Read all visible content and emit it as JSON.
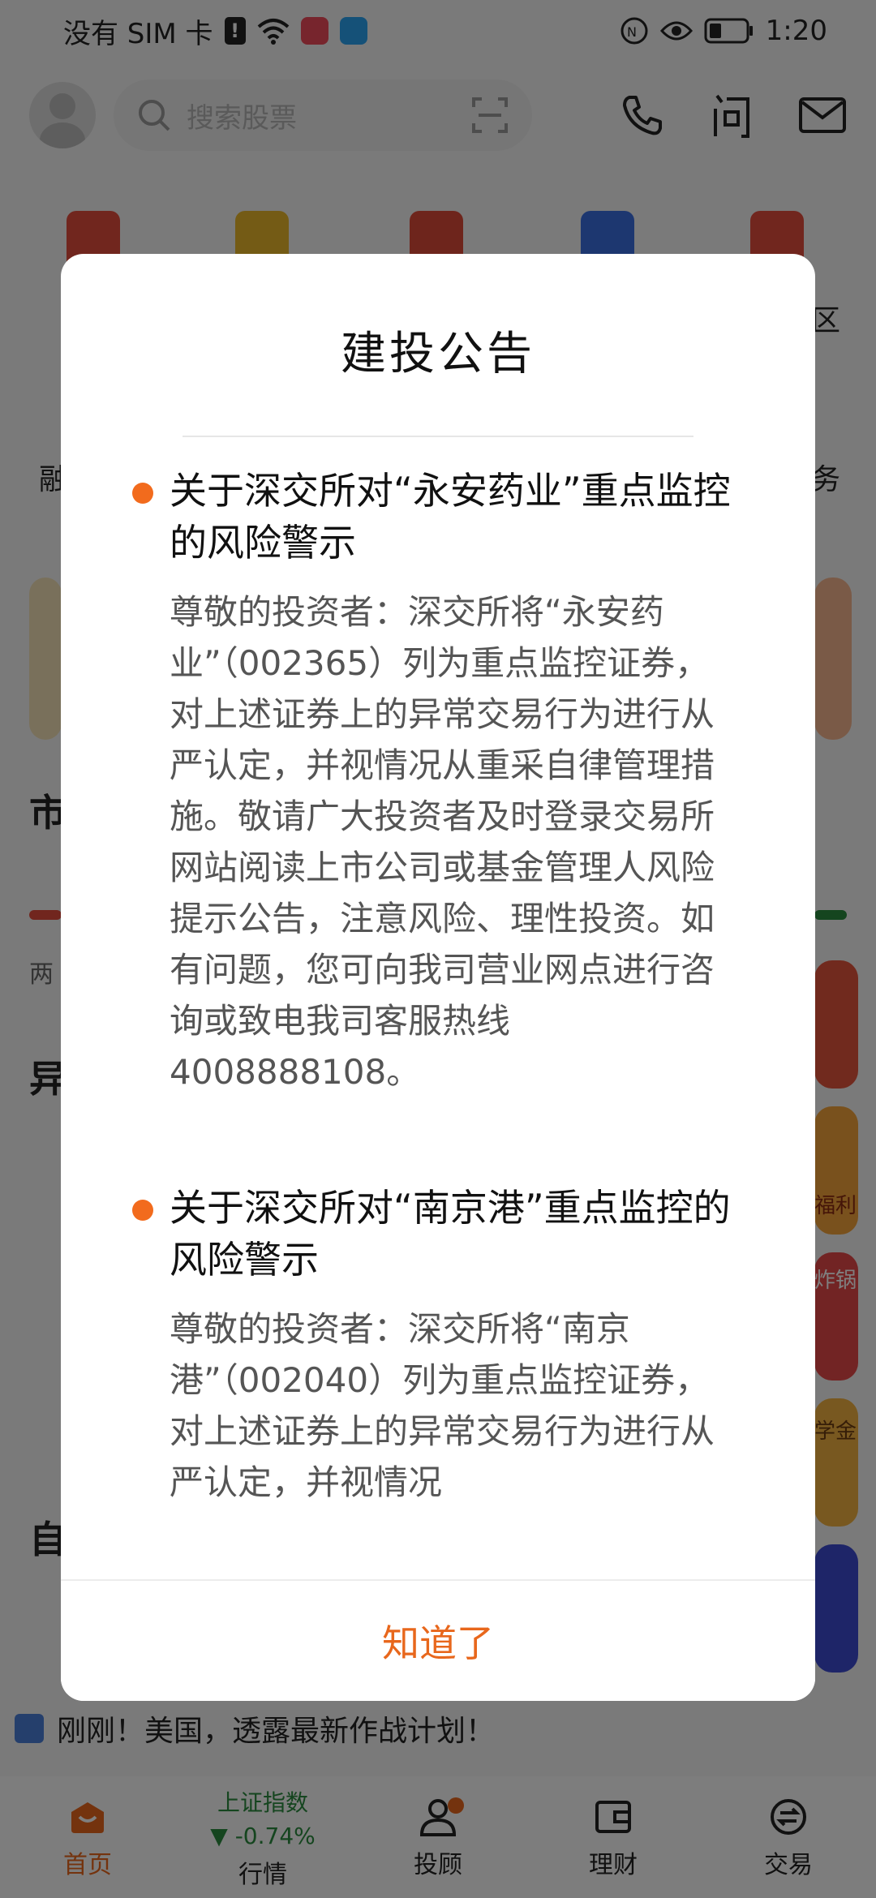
{
  "status_bar": {
    "carrier": "没有 SIM 卡",
    "sim_alert": "!",
    "time": "1:20"
  },
  "header": {
    "search_placeholder": "搜索股票"
  },
  "background": {
    "left_label_1": "融",
    "right_label_1": "区",
    "right_label_2": "务",
    "section_1": "市",
    "section_2": "异",
    "section_3": "自",
    "left_small": "两",
    "card_right_1": "福利",
    "card_right_2": "炸锅",
    "card_right_3": "学金"
  },
  "news_ticker": {
    "text": "刚刚！美国，透露最新作战计划！"
  },
  "tabbar": {
    "home": "首页",
    "market_index_name": "上证指数",
    "market_index_value": "-0.74%",
    "market": "行情",
    "advisor": "投顾",
    "wealth": "理财",
    "trade": "交易"
  },
  "dialog": {
    "title": "建投公告",
    "notices": [
      {
        "title": "关于深交所对“永安药业”重点监控的风险警示",
        "body": "尊敬的投资者：深交所将“永安药业”（002365）列为重点监控证券，对上述证券上的异常交易行为进行从严认定，并视情况从重采自律管理措施。敬请广大投资者及时登录交易所网站阅读上市公司或基金管理人风险提示公告，注意风险、理性投资。如有问题，您可向我司营业网点进行咨询或致电我司客服热线4008888108。"
      },
      {
        "title": "关于深交所对“南京港”重点监控的风险警示",
        "body": "尊敬的投资者：深交所将“南京港”（002040）列为重点监控证券，对上述证券上的异常交易行为进行从严认定，并视情况"
      }
    ],
    "confirm_label": "知道了"
  },
  "colors": {
    "accent": "#e8671c",
    "notice_dot": "#f26b1d",
    "index_down": "#2a8a3e"
  }
}
